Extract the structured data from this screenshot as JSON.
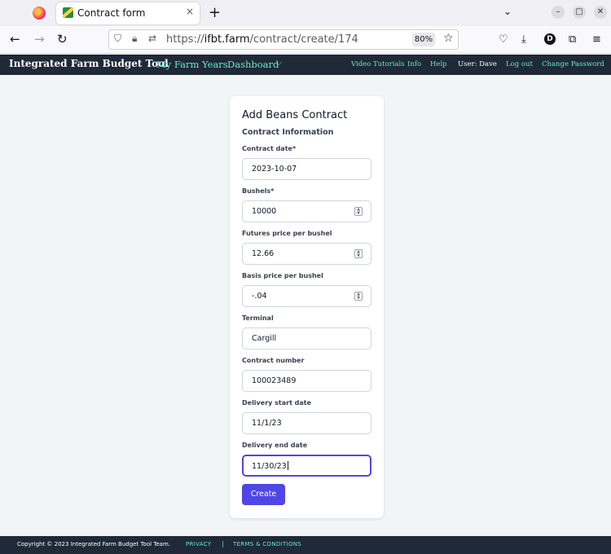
{
  "browser": {
    "tab_title": "Contract form",
    "tab_close_icon": "×",
    "new_tab_icon": "+",
    "url_prefix": "https://",
    "url_host": "ifbt.farm",
    "url_path": "/contract/create/174",
    "zoom": "80%",
    "account_initial": "D"
  },
  "header": {
    "brand": "Integrated Farm Budget Tool",
    "nav_my_farm_years": "My Farm Years",
    "nav_dashboard": "Dashboard",
    "video_tutorials": "Video Tutorials",
    "info": "Info",
    "help": "Help",
    "user": "User: Dave",
    "logout": "Log out",
    "change_password": "Change Password"
  },
  "form": {
    "title": "Add Beans Contract",
    "section": "Contract Information",
    "fields": [
      {
        "label": "Contract date*",
        "value": "2023-10-07"
      },
      {
        "label": "Bushels*",
        "value": "10000"
      },
      {
        "label": "Futures price per bushel",
        "value": "12.66"
      },
      {
        "label": "Basis price per bushel",
        "value": "-.04"
      },
      {
        "label": "Terminal",
        "value": "Cargill"
      },
      {
        "label": "Contract number",
        "value": "100023489"
      },
      {
        "label": "Delivery start date",
        "value": "11/1/23"
      },
      {
        "label": "Delivery end date",
        "value": "11/30/23"
      }
    ],
    "submit": "Create"
  },
  "footer": {
    "copyright": "Copyright © 2023 Integrated Farm Budget Tool Team.",
    "privacy": "PRIVACY",
    "separator": "|",
    "terms": "TERMS & CONDITIONS"
  },
  "colors": {
    "header_bg": "#1f2937",
    "link_teal": "#67e8d4",
    "primary_button": "#4f46e5"
  }
}
